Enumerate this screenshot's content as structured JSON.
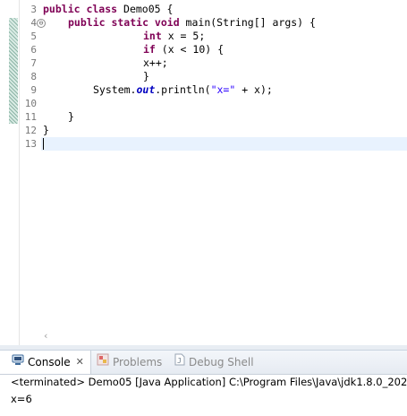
{
  "editor": {
    "line_numbers": [
      "3",
      "4",
      "5",
      "6",
      "7",
      "8",
      "9",
      "10",
      "11",
      "12",
      "13"
    ],
    "fold_marker": "⊖",
    "code_lines": [
      [
        "public class Demo05 {"
      ],
      [
        "public static void main(String[] args) {"
      ],
      [
        "int x = 5;"
      ],
      [
        "if (x < 10) {"
      ],
      [
        "x++;"
      ],
      [
        "}"
      ],
      [
        "System.out.println(\"x=\" + x);"
      ],
      [
        ""
      ],
      [
        "}"
      ],
      [
        "}"
      ],
      [
        ""
      ]
    ],
    "tokens": {
      "l3_kw": "public class",
      "l3_rest": " Demo05 {",
      "l4_kw": "public static void",
      "l4_rest": " main(String[] args) {",
      "l5_kw": "int",
      "l5_rest": " x = 5;",
      "l6_kw": "if",
      "l6_rest": " (x < 10) {",
      "l7": "x++;",
      "l8": "}",
      "l9_a": "System.",
      "l9_field": "out",
      "l9_b": ".println(",
      "l9_str": "\"x=\"",
      "l9_c": " + x);",
      "l11": "}",
      "l12": "}"
    },
    "scroll_left_arrow": "‹"
  },
  "console_view": {
    "tabs": [
      {
        "label": "Console",
        "icon": "console-icon",
        "close": "✕"
      },
      {
        "label": "Problems",
        "icon": "problems-icon"
      },
      {
        "label": "Debug Shell",
        "icon": "debug-shell-icon"
      }
    ],
    "status": "<terminated> Demo05 [Java Application] C:\\Program Files\\Java\\jdk1.8.0_202",
    "output": "x=6"
  },
  "colors": {
    "keyword": "#7f0055",
    "string": "#2a00ff",
    "static_field": "#0000c0",
    "current_line": "#e8f2fe"
  }
}
